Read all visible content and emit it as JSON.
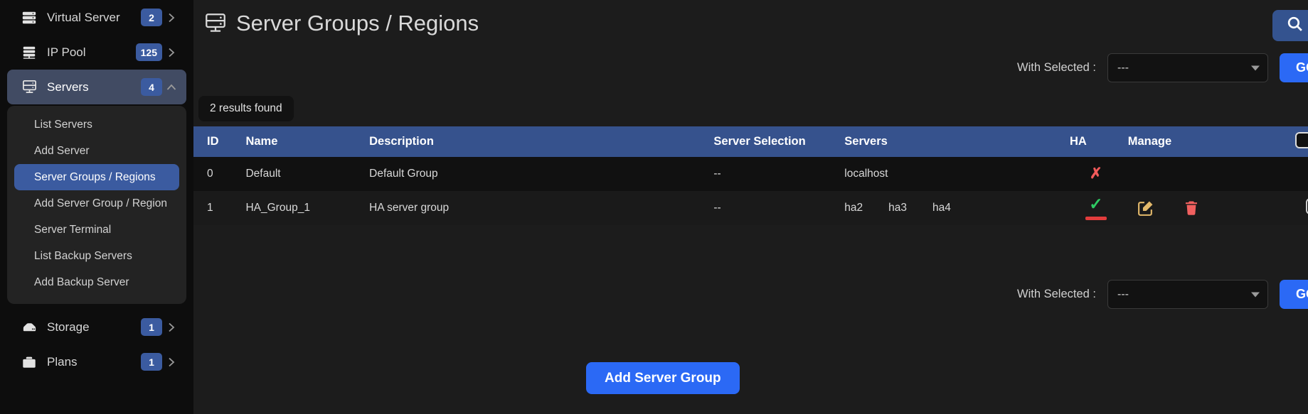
{
  "sidebar": {
    "items": [
      {
        "label": "Virtual Server",
        "badge": "2",
        "icon": "server-stack-icon",
        "chevron": "chevron-right-icon",
        "active": false
      },
      {
        "label": "IP Pool",
        "badge": "125",
        "icon": "ip-pool-icon",
        "chevron": "chevron-right-icon",
        "active": false
      },
      {
        "label": "Servers",
        "badge": "4",
        "icon": "server-icon",
        "chevron": "chevron-up-icon",
        "active": true
      },
      {
        "label": "Storage",
        "badge": "1",
        "icon": "storage-icon",
        "chevron": "chevron-right-icon",
        "active": false
      },
      {
        "label": "Plans",
        "badge": "1",
        "icon": "plans-icon",
        "chevron": "chevron-right-icon",
        "active": false
      }
    ],
    "submenu": [
      {
        "label": "List Servers",
        "active": false
      },
      {
        "label": "Add Server",
        "active": false
      },
      {
        "label": "Server Groups / Regions",
        "active": true
      },
      {
        "label": "Add Server Group / Region",
        "active": false
      },
      {
        "label": "Server Terminal",
        "active": false
      },
      {
        "label": "List Backup Servers",
        "active": false
      },
      {
        "label": "Add Backup Server",
        "active": false
      }
    ]
  },
  "header": {
    "title": "Server Groups / Regions",
    "title_icon": "server-rack-icon",
    "search_icon": "search-icon"
  },
  "toolbar": {
    "with_selected_label": "With Selected :",
    "select_value": "---",
    "go_label": "GO"
  },
  "results": {
    "chip": "2 results found"
  },
  "table": {
    "columns": [
      "ID",
      "Name",
      "Description",
      "Server Selection",
      "Servers",
      "HA",
      "Manage",
      ""
    ],
    "header_checkbox": "unchecked",
    "rows": [
      {
        "id": "0",
        "name": "Default",
        "description": "Default Group",
        "server_selection": "--",
        "servers": [
          "localhost"
        ],
        "ha": "no",
        "manage": [],
        "checkbox": "none"
      },
      {
        "id": "1",
        "name": "HA_Group_1",
        "description": "HA server group",
        "server_selection": "--",
        "servers": [
          "ha2",
          "ha3",
          "ha4"
        ],
        "ha": "yes",
        "manage": [
          "edit-icon",
          "delete-icon"
        ],
        "checkbox": "unchecked"
      }
    ]
  },
  "footer": {
    "add_button": "Add Server Group"
  },
  "colors": {
    "accent_blue": "#2b69f5",
    "header_blue": "#36528d",
    "badge_blue": "#3b5ba0",
    "ha_yes_green": "#2ecb63",
    "ha_no_red": "#f05a5a",
    "edit_icon": "#e3b96b",
    "delete_icon": "#f0605f",
    "page_bg": "#1c1c1c",
    "sidebar_bg": "#0d0d0d"
  }
}
